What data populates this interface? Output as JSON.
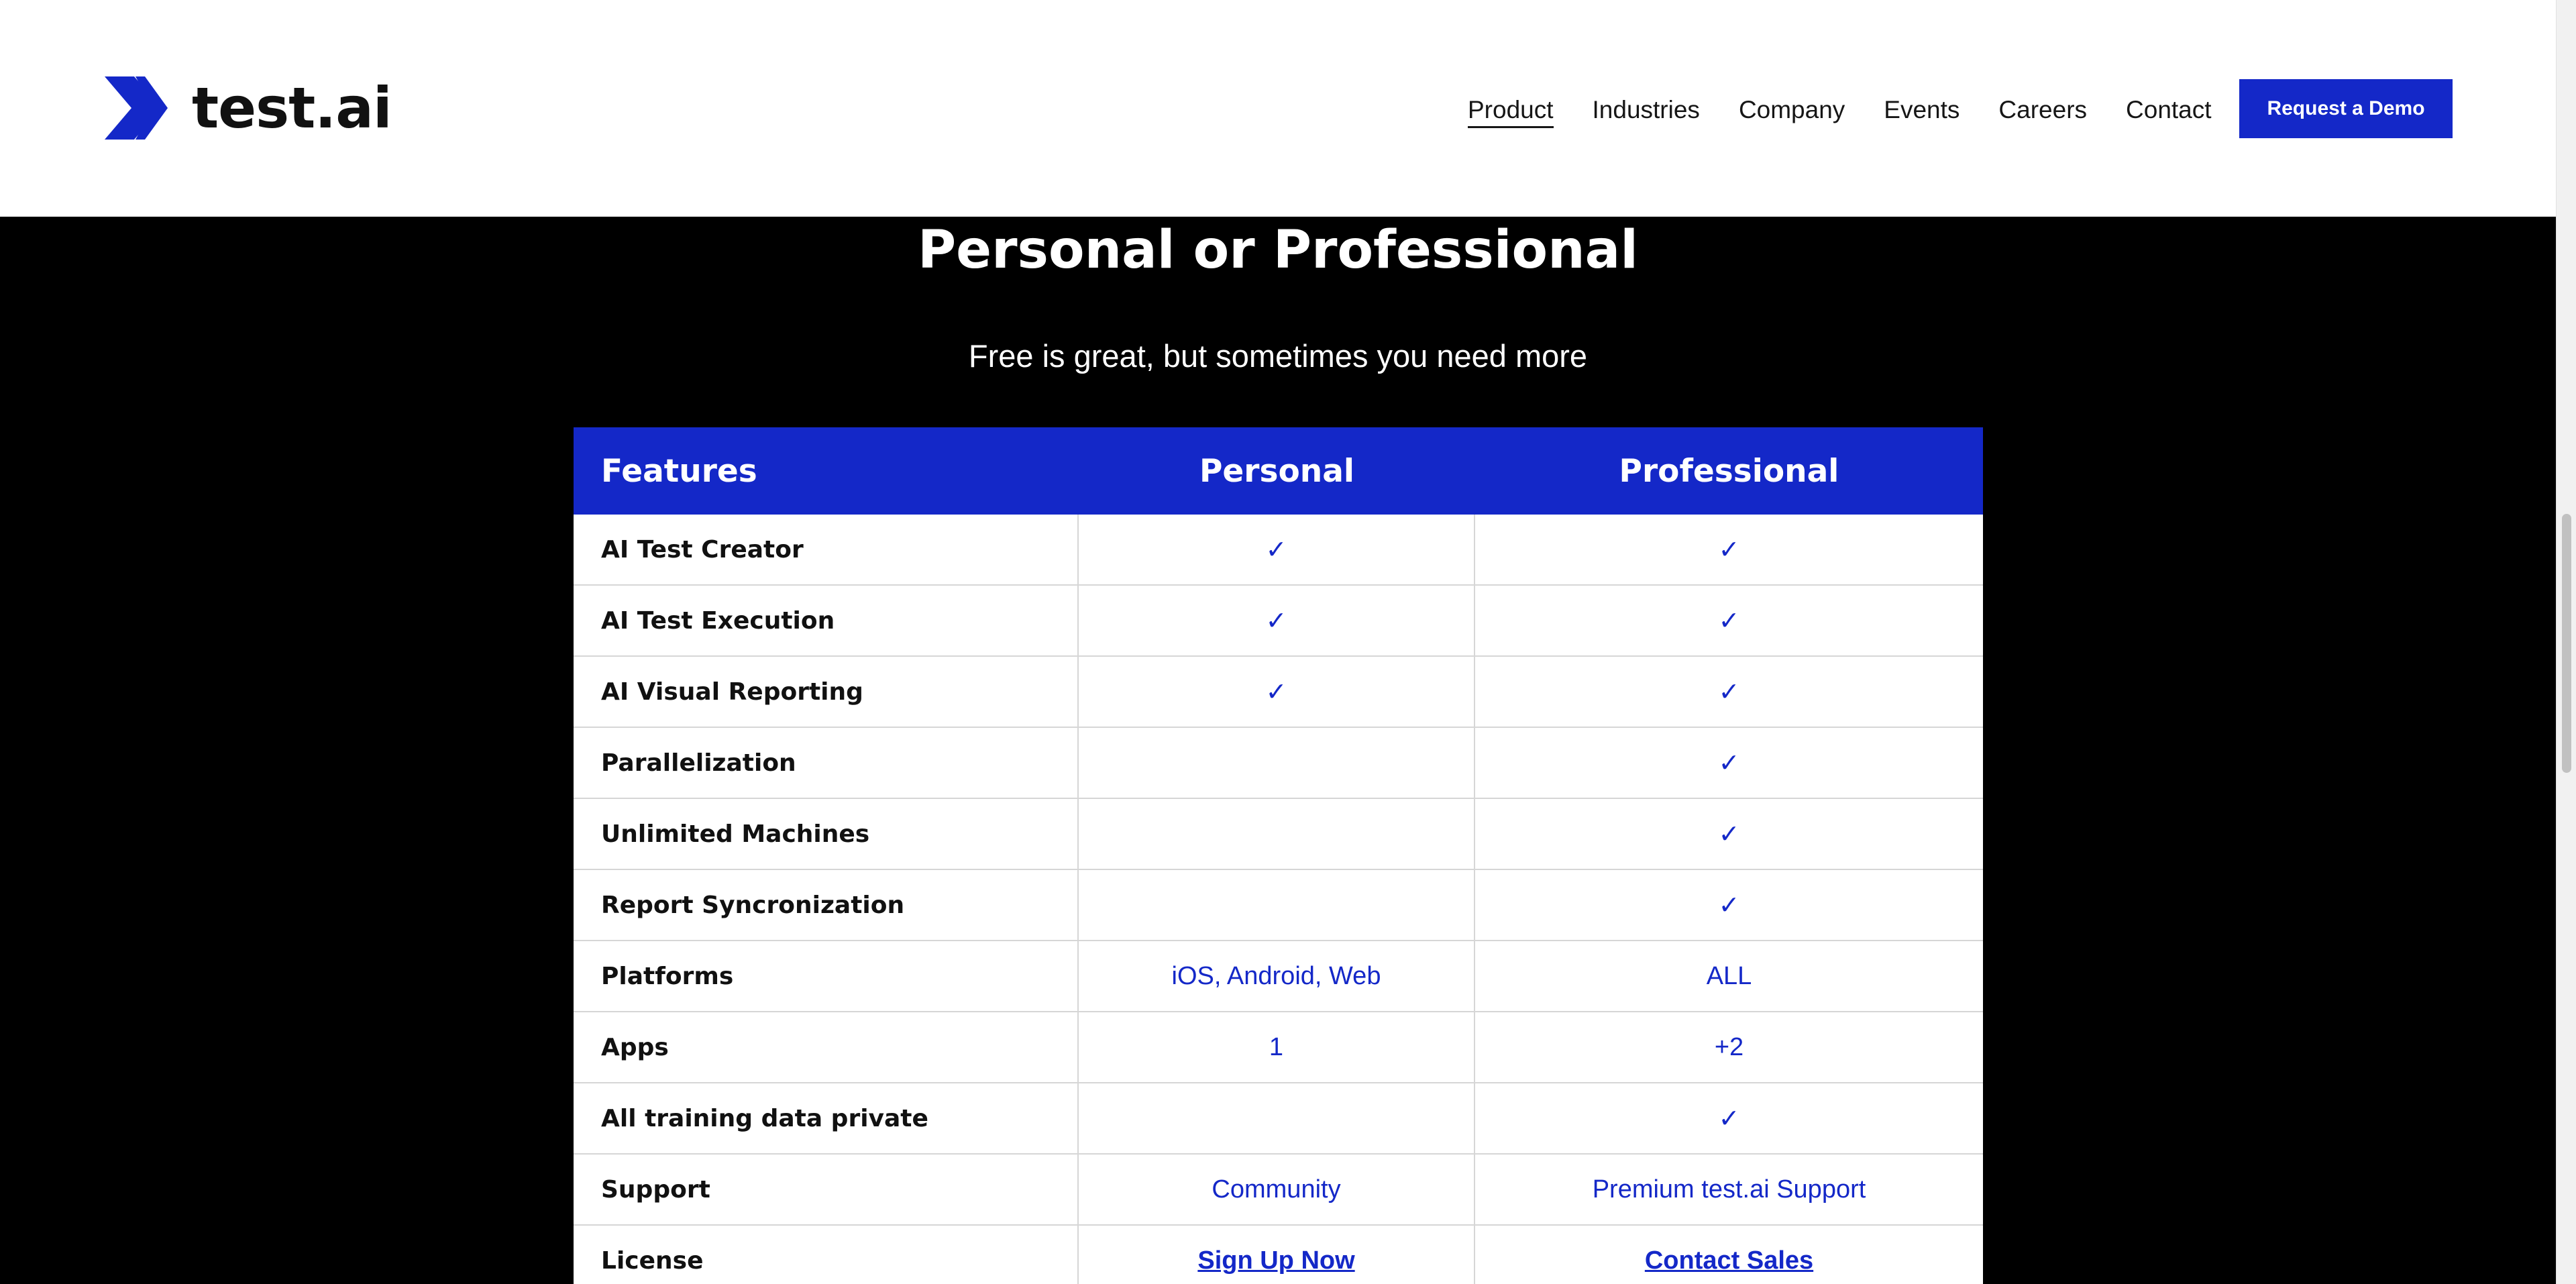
{
  "header": {
    "logo_text": "test.ai",
    "nav": [
      {
        "label": "Product",
        "active": true
      },
      {
        "label": "Industries",
        "active": false
      },
      {
        "label": "Company",
        "active": false
      },
      {
        "label": "Events",
        "active": false
      },
      {
        "label": "Careers",
        "active": false
      },
      {
        "label": "Contact",
        "active": false
      }
    ],
    "cta_label": "Request a Demo"
  },
  "section": {
    "title": "Personal or Professional",
    "subtitle": "Free is great, but sometimes you need more"
  },
  "table": {
    "headers": [
      "Features",
      "Personal",
      "Professional"
    ],
    "rows": [
      {
        "feature": "AI Test Creator",
        "personal": "✓",
        "professional": "✓"
      },
      {
        "feature": "AI Test Execution",
        "personal": "✓",
        "professional": "✓"
      },
      {
        "feature": "AI Visual Reporting",
        "personal": "✓",
        "professional": "✓"
      },
      {
        "feature": "Parallelization",
        "personal": "",
        "professional": "✓"
      },
      {
        "feature": "Unlimited Machines",
        "personal": "",
        "professional": "✓"
      },
      {
        "feature": "Report Syncronization",
        "personal": "",
        "professional": "✓"
      },
      {
        "feature": "Platforms",
        "personal": "iOS, Android, Web",
        "professional": "ALL"
      },
      {
        "feature": "Apps",
        "personal": "1",
        "professional": "+2"
      },
      {
        "feature": "All training data private",
        "personal": "",
        "professional": "✓"
      },
      {
        "feature": "Support",
        "personal": "Community",
        "professional": "Premium test.ai Support"
      },
      {
        "feature": "License",
        "personal": "Sign Up Now",
        "professional": "Contact Sales"
      }
    ]
  },
  "colors": {
    "accent": "#1428c8",
    "background": "#000000",
    "header_bg": "#ffffff"
  }
}
